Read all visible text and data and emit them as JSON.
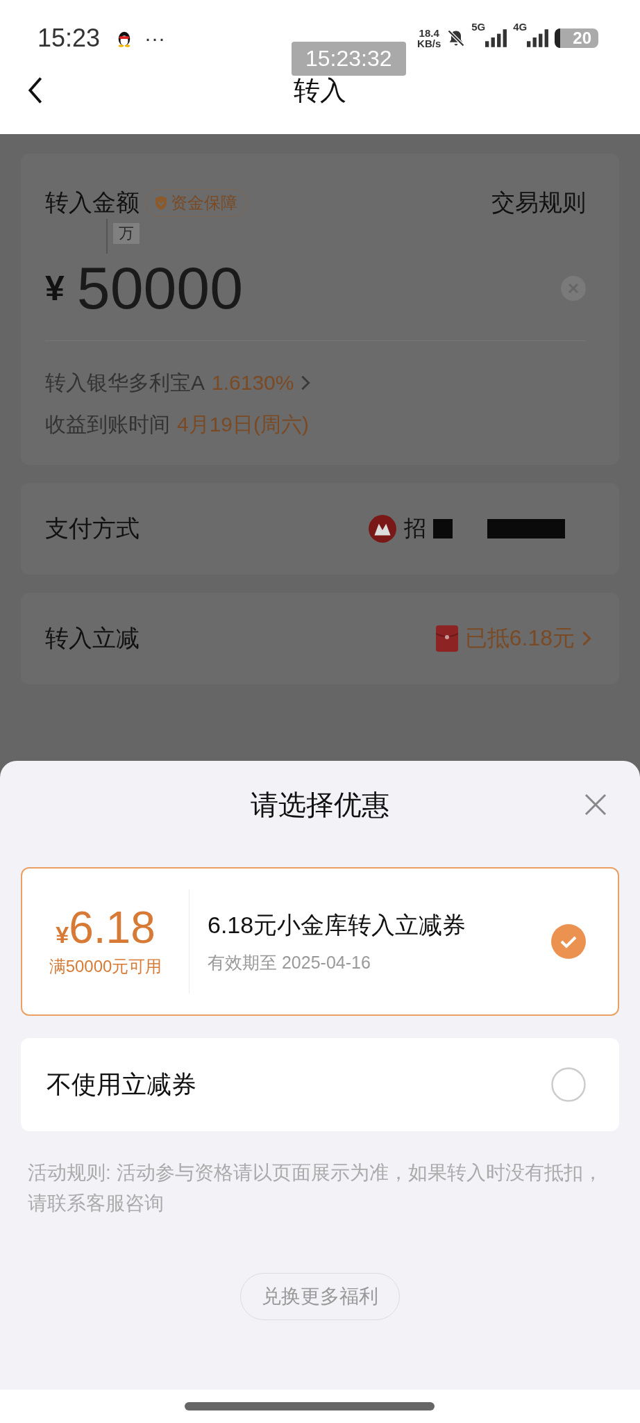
{
  "status_bar": {
    "time": "15:23",
    "dots": "···",
    "network_speed": [
      "18.4",
      "KB/s"
    ],
    "net_a": "5G",
    "net_b": "4G",
    "battery": "20",
    "clock_overlay": "15:23:32"
  },
  "nav": {
    "title": "转入"
  },
  "amount_card": {
    "label": "转入金额",
    "badge": "资金保障",
    "rules_link": "交易规则",
    "unit_hint": "万",
    "currency": "¥",
    "amount": "50000",
    "fund_text": "转入银华多利宝A",
    "rate": "1.6130%",
    "arrival_label": "收益到账时间",
    "arrival_date": "4月19日(周六)"
  },
  "payment": {
    "label": "支付方式",
    "bank_text": "招"
  },
  "discount": {
    "label": "转入立减",
    "value": "已抵6.18元"
  },
  "sheet": {
    "title": "请选择优惠",
    "options": [
      {
        "kind": "coupon",
        "symbol": "¥",
        "amount": "6.18",
        "condition": "满50000元可用",
        "name": "6.18元小金库转入立减券",
        "expiry": "有效期至 2025-04-16",
        "selected": true
      },
      {
        "kind": "none",
        "label": "不使用立减券",
        "selected": false
      }
    ],
    "rules": "活动规则: 活动参与资格请以页面展示为准，如果转入时没有抵扣，请联系客服咨询",
    "button": "兑换更多福利"
  }
}
